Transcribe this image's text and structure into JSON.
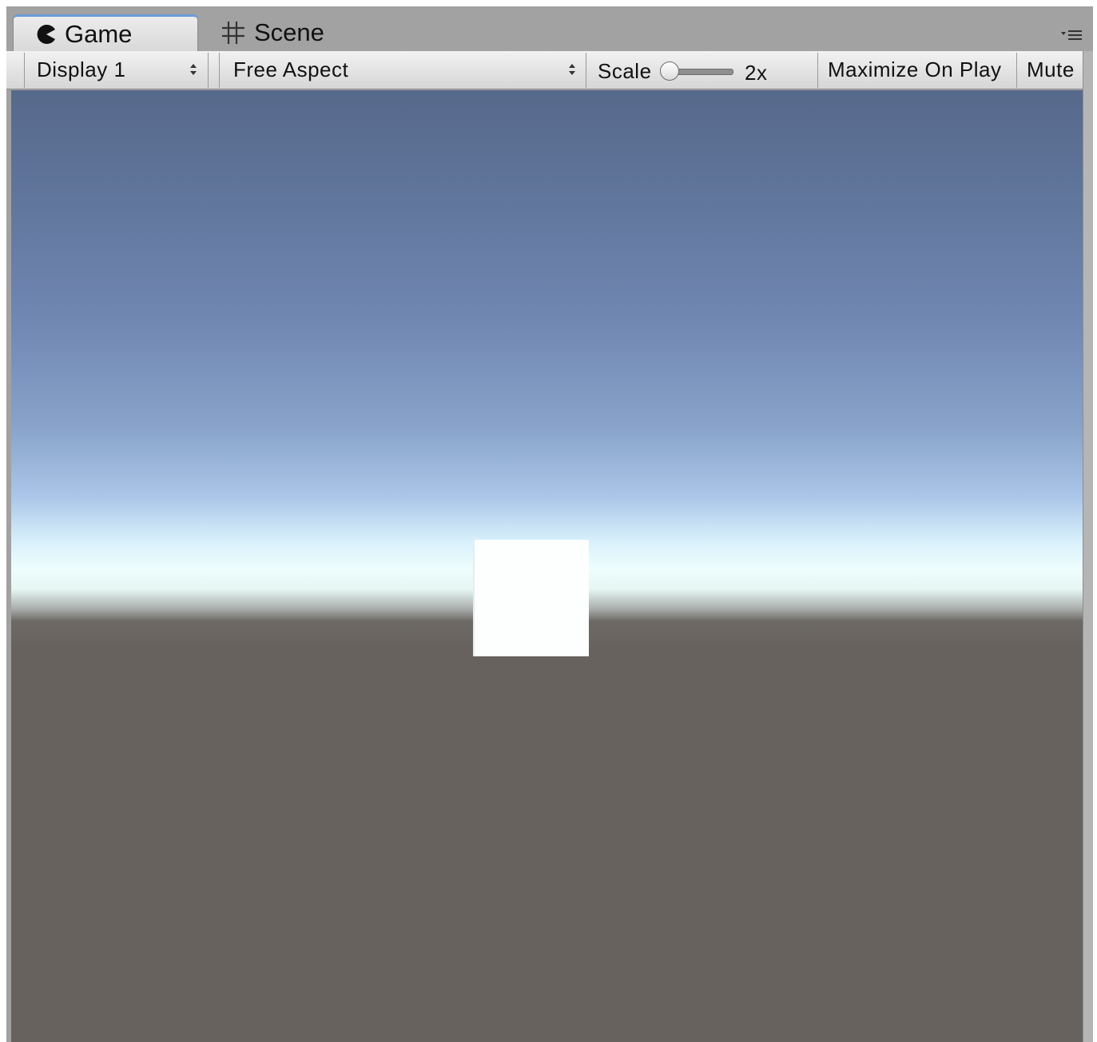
{
  "tabs": [
    {
      "label": "Game",
      "icon": "pacman-icon",
      "active": true
    },
    {
      "label": "Scene",
      "icon": "grid-icon",
      "active": false
    }
  ],
  "toolbar": {
    "display": {
      "selected": "Display 1"
    },
    "aspect": {
      "selected": "Free Aspect"
    },
    "scale": {
      "label": "Scale",
      "value_label": "2x",
      "slider_position": 0.0
    },
    "maximize_label": "Maximize On Play",
    "mute_label": "Mute"
  },
  "colors": {
    "tab_accent": "#6b9bd8",
    "sky_top": "#56698b",
    "horizon": "#eefefd",
    "ground": "#67625e",
    "cube": "#fdfefe"
  },
  "viewport": {
    "objects": [
      {
        "name": "cube",
        "color": "#fdfefe"
      }
    ]
  }
}
